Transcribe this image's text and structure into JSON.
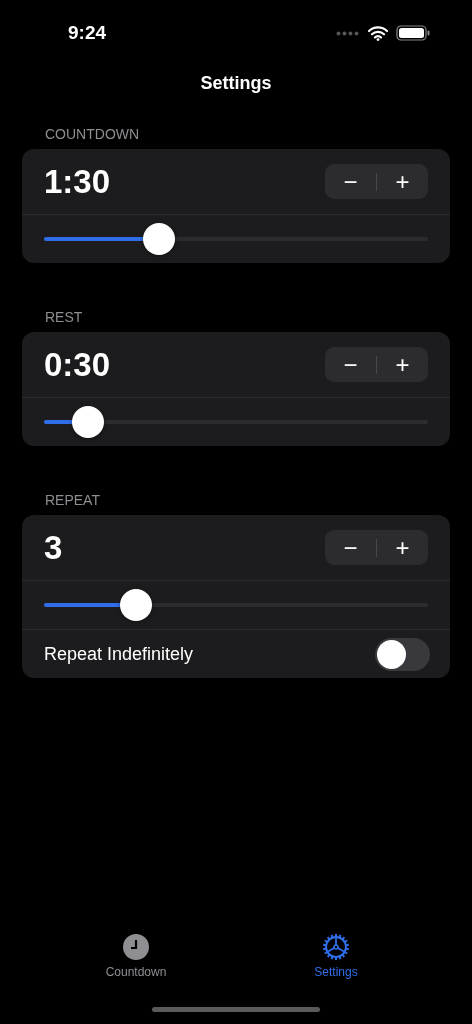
{
  "status_bar": {
    "time": "9:24"
  },
  "title": "Settings",
  "sections": [
    {
      "label": "COUNTDOWN",
      "value": "1:30",
      "decrement": "−",
      "increment": "+",
      "level": 0.3
    },
    {
      "label": "REST",
      "value": "0:30",
      "decrement": "−",
      "increment": "+",
      "level": 0.115
    },
    {
      "label": "REPEAT",
      "value": "3",
      "decrement": "−",
      "increment": "+",
      "level": 0.24,
      "toggle": {
        "label": "Repeat Indefinitely",
        "on": false
      }
    }
  ],
  "tabs": [
    {
      "label": "Countdown",
      "kind": "clock",
      "selected": false
    },
    {
      "label": "Settings",
      "kind": "gear",
      "selected": true
    }
  ]
}
